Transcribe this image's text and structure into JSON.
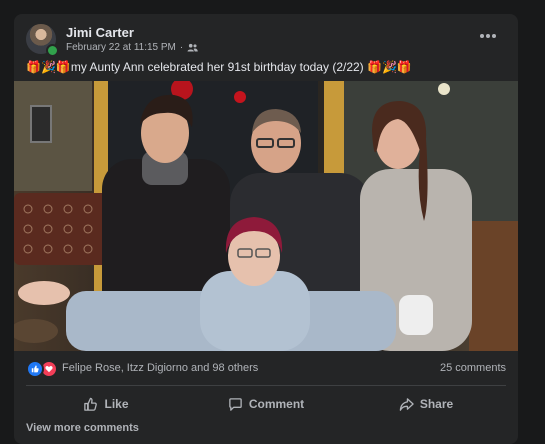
{
  "post": {
    "author": "Jimi Carter",
    "date": "February 22 at 11:15 PM",
    "privacy_separator": "·",
    "caption": "🎁🎉🎁my Aunty Ann celebrated her 91st birthday today (2/22) 🎁🎉🎁",
    "photo_alt": "Birthday photo"
  },
  "reactions": {
    "like_icon": "thumbs-up-icon",
    "love_icon": "heart-icon",
    "names": "Felipe Rose, Itzz Digiorno and 98 others",
    "comments": "25 comments"
  },
  "actions": {
    "like": "Like",
    "comment": "Comment",
    "share": "Share"
  },
  "footer": {
    "view_more": "View more comments"
  },
  "colors": {
    "page_bg": "#18191a",
    "card_bg": "#242526",
    "text_primary": "#e4e6eb",
    "text_secondary": "#b0b3b8",
    "like_blue": "#2078f4",
    "love_red": "#f33e58",
    "online_green": "#31a24c"
  }
}
